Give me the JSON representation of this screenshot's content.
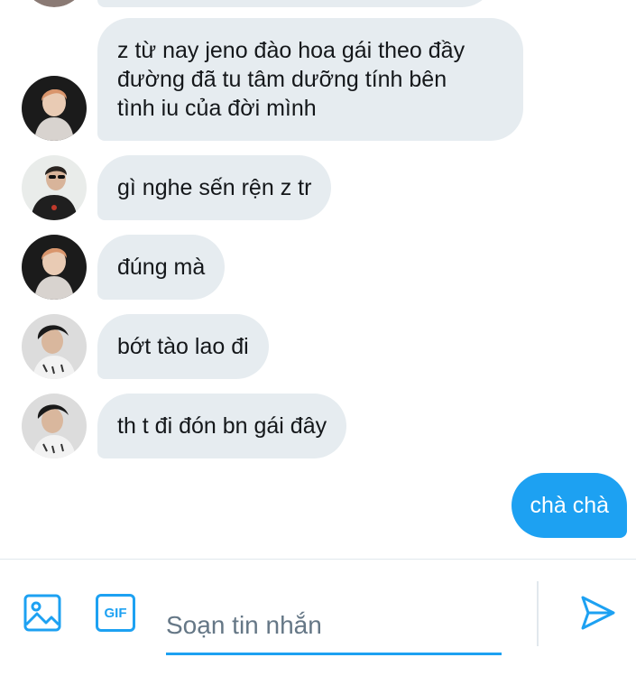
{
  "messages": [
    {
      "text": "z từ nay jeno đào hoa gái theo đầy\nđường đã tu tâm dưỡng tính bên\ntình iu của đời mình",
      "sender": "avatar-orange-hair"
    },
    {
      "text": "gì nghe sến rện z tr",
      "sender": "avatar-sunglasses"
    },
    {
      "text": "đúng mà",
      "sender": "avatar-orange-hair"
    },
    {
      "text": "bớt tào lao đi",
      "sender": "avatar-curly-hair"
    },
    {
      "text": "th t đi đón bn gái đây",
      "sender": "avatar-curly-hair"
    }
  ],
  "outgoing": {
    "text": "chà chà"
  },
  "composer": {
    "placeholder": "Soạn tin nhắn",
    "gif_label": "GIF",
    "media_icon": "image-icon",
    "send_icon": "send-icon"
  },
  "colors": {
    "accent": "#1da1f2",
    "incoming_bubble": "#e6ecf0",
    "text": "#14171a",
    "placeholder": "#657786"
  }
}
